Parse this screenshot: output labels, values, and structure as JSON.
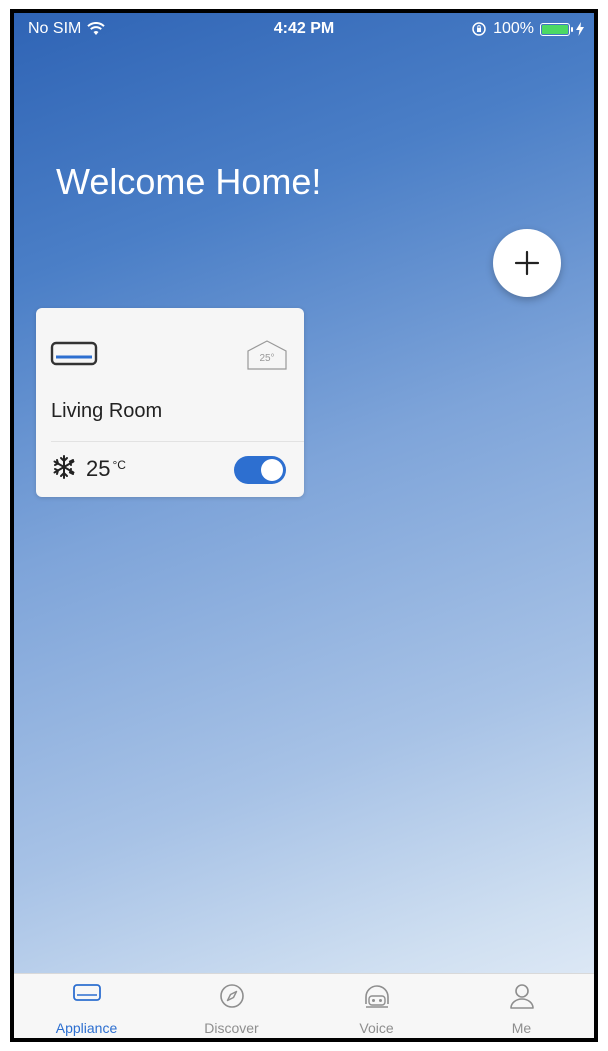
{
  "status_bar": {
    "carrier": "No SIM",
    "time": "4:42 PM",
    "battery": "100%",
    "battery_level": 1.0
  },
  "home": {
    "welcome": "Welcome Home!",
    "add_icon": "plus-icon"
  },
  "device_card": {
    "room_temp": "25°",
    "room_name": "Living Room",
    "mode_icon": "snowflake-icon",
    "temperature": "25",
    "unit": "°C",
    "power_on": true
  },
  "tabs": [
    {
      "label": "Appliance",
      "icon": "appliance-icon",
      "active": true
    },
    {
      "label": "Discover",
      "icon": "compass-icon",
      "active": false
    },
    {
      "label": "Voice",
      "icon": "voice-robot-icon",
      "active": false
    },
    {
      "label": "Me",
      "icon": "person-icon",
      "active": false
    }
  ],
  "colors": {
    "accent": "#2d6fd0",
    "battery": "#4cd964",
    "inactive_tab": "#8e8e8e"
  }
}
